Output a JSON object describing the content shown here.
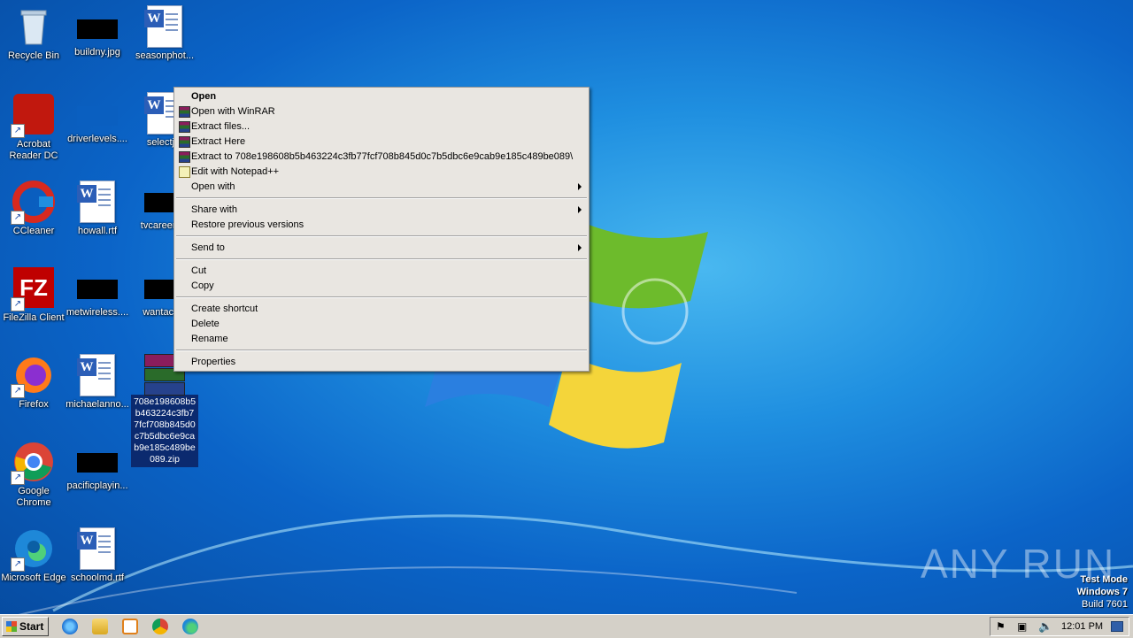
{
  "desktop": {
    "icons": [
      {
        "label": "Recycle Bin"
      },
      {
        "label": "buildny.jpg"
      },
      {
        "label": "seasonphot..."
      },
      {
        "label": "Acrobat\nReader DC"
      },
      {
        "label": "driverlevels...."
      },
      {
        "label": "selectj..."
      },
      {
        "label": "CCleaner"
      },
      {
        "label": "howall.rtf"
      },
      {
        "label": "tvcareers..."
      },
      {
        "label": "FileZilla Client"
      },
      {
        "label": "metwireless...."
      },
      {
        "label": "wantacc..."
      },
      {
        "label": "Firefox"
      },
      {
        "label": "michaelanno..."
      },
      {
        "label": "708e198608b5b463224c3fb77fcf708b845d0c7b5dbc6e9cab9e185c489be089.zip"
      },
      {
        "label": "Google\nChrome"
      },
      {
        "label": "pacificplayin..."
      },
      {
        "label": "Microsoft Edge"
      },
      {
        "label": "schoolmd.rtf"
      }
    ]
  },
  "context_menu": {
    "items": [
      {
        "label": "Open"
      },
      {
        "label": "Open with WinRAR"
      },
      {
        "label": "Extract files..."
      },
      {
        "label": "Extract Here"
      },
      {
        "label": "Extract to 708e198608b5b463224c3fb77fcf708b845d0c7b5dbc6e9cab9e185c489be089\\"
      },
      {
        "label": "Edit with Notepad++"
      },
      {
        "label": "Open with"
      },
      {
        "label": "Share with"
      },
      {
        "label": "Restore previous versions"
      },
      {
        "label": "Send to"
      },
      {
        "label": "Cut"
      },
      {
        "label": "Copy"
      },
      {
        "label": "Create shortcut"
      },
      {
        "label": "Delete"
      },
      {
        "label": "Rename"
      },
      {
        "label": "Properties"
      }
    ]
  },
  "taskbar": {
    "start_label": "Start",
    "clock": "12:01 PM"
  },
  "watermark": "ANY RUN",
  "system_overlay": {
    "line1": "Test Mode",
    "line2": "Windows 7",
    "line3": "Build 7601"
  }
}
